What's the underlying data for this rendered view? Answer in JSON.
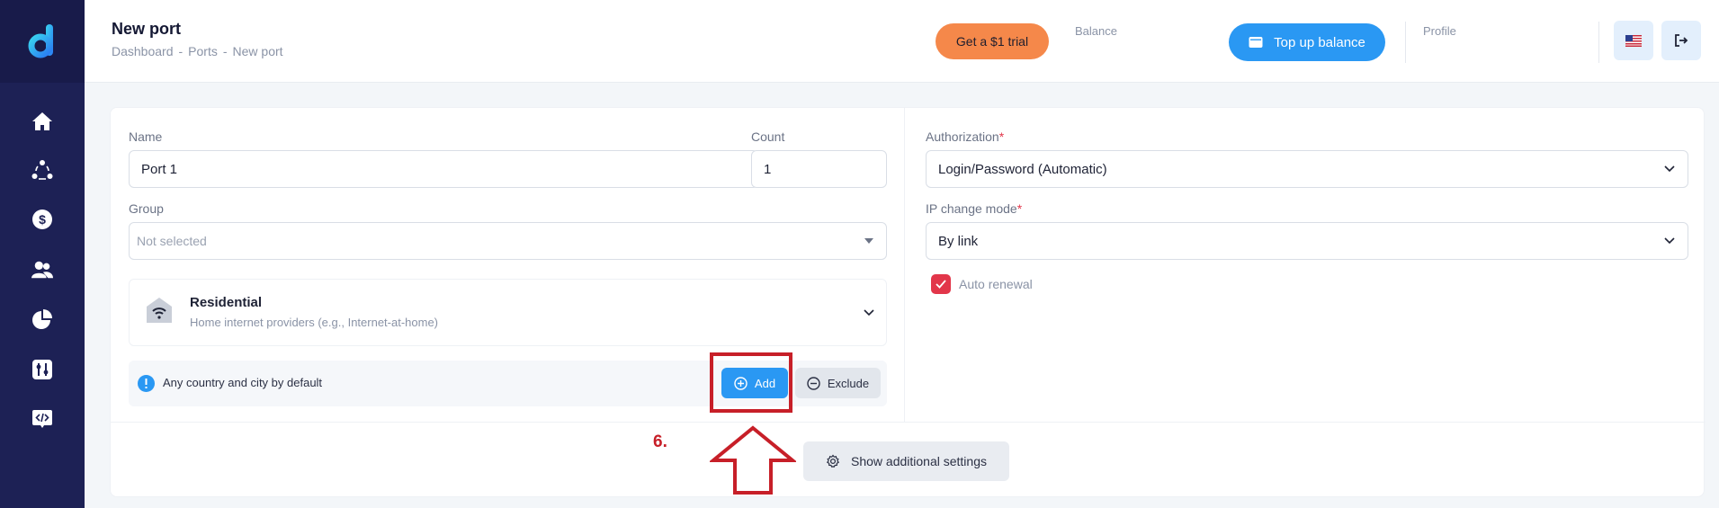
{
  "header": {
    "title": "New port",
    "breadcrumb": [
      "Dashboard",
      "Ports",
      "New port"
    ],
    "trial_label": "Get a $1 trial",
    "balance_label": "Balance",
    "topup_label": "Top up balance",
    "profile_label": "Profile"
  },
  "sidebar": {
    "items": [
      "home-icon",
      "network-icon",
      "dollar-icon",
      "users-icon",
      "pie-chart-icon",
      "tools-icon",
      "api-code-icon"
    ]
  },
  "form": {
    "name_label": "Name",
    "name_value": "Port 1",
    "count_label": "Count",
    "count_value": "1",
    "group_label": "Group",
    "group_placeholder": "Not selected",
    "type_title": "Residential",
    "type_desc": "Home internet providers (e.g., Internet-at-home)",
    "location_info": "Any country and city by default",
    "add_label": "Add",
    "exclude_label": "Exclude",
    "authorization_label": "Authorization",
    "authorization_value": "Login/Password (Automatic)",
    "ip_mode_label": "IP change mode",
    "ip_mode_value": "By link",
    "auto_renewal_label": "Auto renewal",
    "auto_renewal_checked": true,
    "required_mark": "*",
    "additional_settings_label": "Show additional settings"
  },
  "annotation": {
    "step_label": "6."
  },
  "colors": {
    "sidebar": "#1d2155",
    "accent_blue": "#2a98f3",
    "trial_orange": "#f5884a",
    "checkbox_red": "#e2364a",
    "annotation_red": "#c71f28"
  }
}
